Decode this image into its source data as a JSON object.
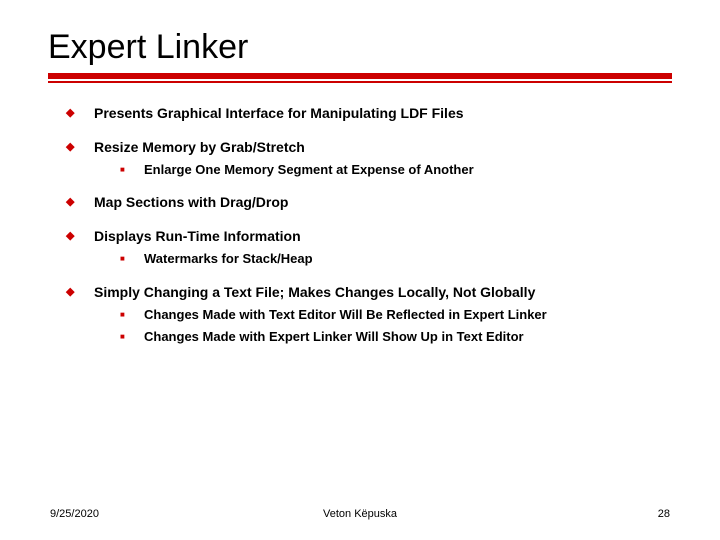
{
  "title": "Expert Linker",
  "bullets": [
    {
      "text": "Presents Graphical Interface for Manipulating LDF Files",
      "sub": []
    },
    {
      "text": "Resize Memory by Grab/Stretch",
      "sub": [
        {
          "text": "Enlarge One Memory Segment at Expense of Another"
        }
      ]
    },
    {
      "text": "Map Sections with Drag/Drop",
      "sub": []
    },
    {
      "text": "Displays Run-Time Information",
      "sub": [
        {
          "text": "Watermarks for Stack/Heap"
        }
      ]
    },
    {
      "text": "Simply Changing a Text File; Makes Changes Locally, Not Globally",
      "sub": [
        {
          "text": "Changes Made with Text Editor Will Be Reflected in Expert Linker"
        },
        {
          "text": "Changes Made with Expert Linker Will Show Up in Text Editor"
        }
      ]
    }
  ],
  "footer": {
    "date": "9/25/2020",
    "author": "Veton Këpuska",
    "page": "28"
  }
}
